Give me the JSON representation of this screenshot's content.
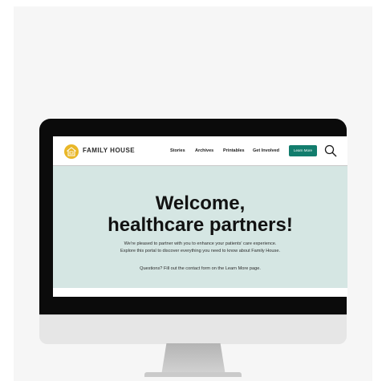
{
  "brand": {
    "name": "FAMILY HOUSE",
    "color": "#e9b728",
    "icon": "house-logo-icon"
  },
  "nav": {
    "items": [
      "Stories",
      "Archives",
      "Printables",
      "Get Involved"
    ],
    "cta": "Learn More",
    "cta_color": "#127d6d",
    "search_icon": "search-icon"
  },
  "hero": {
    "title_line1": "Welcome,",
    "title_line2": "healthcare partners!",
    "body_line1": "We're pleased to partner with you to enhance your patients' care experience.",
    "body_line2": "Explore this portal to discover everything you need to know about Family House.",
    "questions": "Questions? Fill out the contact form on the Learn More page.",
    "background": "#d5e6e3"
  }
}
